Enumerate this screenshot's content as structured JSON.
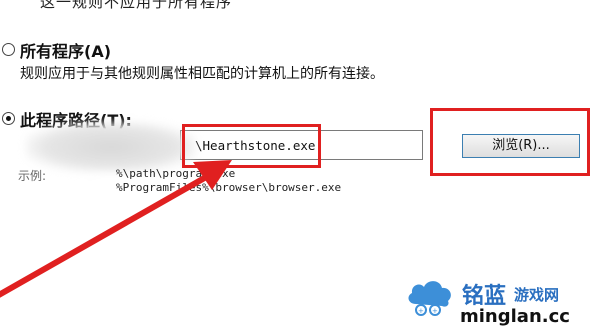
{
  "dialog": {
    "top_cut_text": "这一规则不应用于所有程序",
    "option_all": {
      "label": "所有程序(A)",
      "description": "规则应用于与其他规则属性相匹配的计算机上的所有连接。",
      "checked": false
    },
    "option_path": {
      "label": "此程序路径(T):",
      "checked": true
    },
    "path_field": {
      "value": "\\Hearthstone.exe"
    },
    "browse_button": {
      "label": "浏览(R)..."
    },
    "example": {
      "label": "示例:",
      "line1": "%\\path\\program.exe",
      "line2": "%ProgramFiles%\\browser\\browser.exe"
    }
  },
  "annotations": {
    "highlight_color": "#e02020",
    "arrow_color": "#e02020"
  },
  "watermark": {
    "brand_cn": "铭蓝",
    "brand_suffix": "游戏网",
    "url": "minglan.cc",
    "accent": "#2a6fc0"
  }
}
